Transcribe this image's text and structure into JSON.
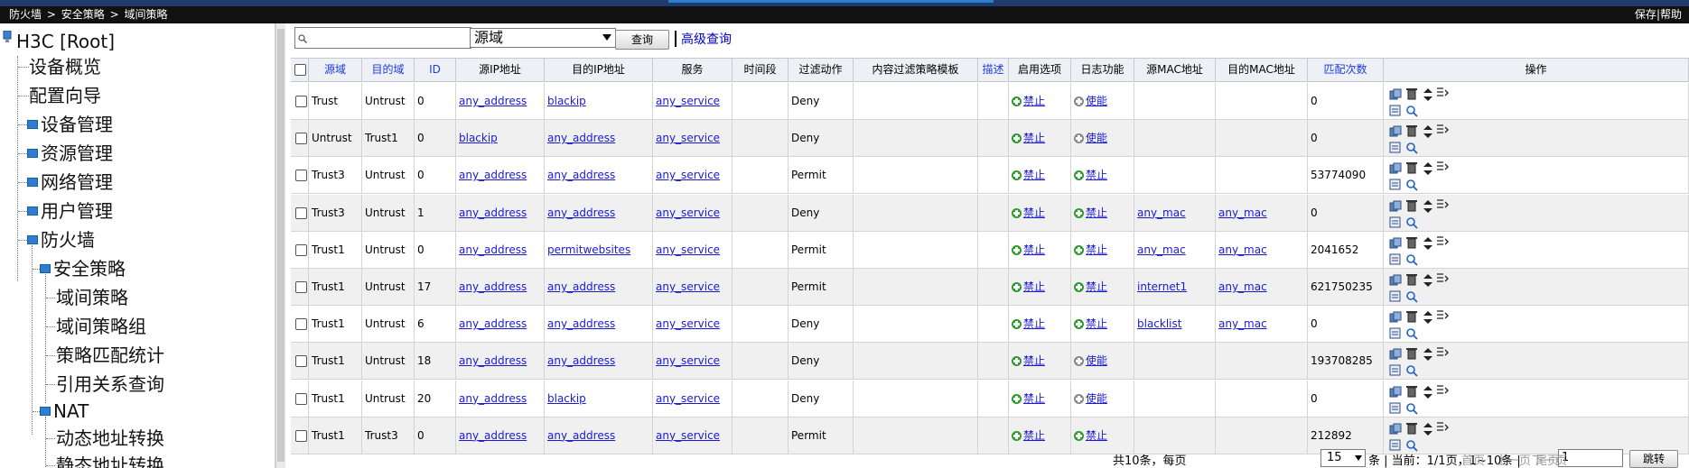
{
  "breadcrumb": [
    "防火墙",
    ">",
    "安全策略",
    ">",
    "域间策略"
  ],
  "top_links": {
    "save": "保存",
    "sep": "|",
    "help": "帮助"
  },
  "sidebar": {
    "root": "H3C [Root]",
    "items": [
      {
        "label": "设备概览"
      },
      {
        "label": "配置向导"
      },
      {
        "label": "设备管理"
      },
      {
        "label": "资源管理"
      },
      {
        "label": "网络管理"
      },
      {
        "label": "用户管理"
      },
      {
        "label": "防火墙"
      },
      {
        "label": "安全策略"
      },
      {
        "label": "域间策略"
      },
      {
        "label": "域间策略组"
      },
      {
        "label": "策略匹配统计"
      },
      {
        "label": "引用关系查询"
      },
      {
        "label": "NAT"
      },
      {
        "label": "动态地址转换"
      },
      {
        "label": "静态地址转换"
      }
    ]
  },
  "search": {
    "placeholder": "",
    "field_value": "源域",
    "query_label": "查询",
    "advanced_label": "高级查询"
  },
  "table": {
    "headers": [
      "源域",
      "目的域",
      "ID",
      "源IP地址",
      "目的IP地址",
      "服务",
      "时间段",
      "过滤动作",
      "内容过滤策略模板",
      "描述",
      "启用选项",
      "日志功能",
      "源MAC地址",
      "目的MAC地址",
      "匹配次数",
      "操作"
    ],
    "sortable": [
      true,
      true,
      true,
      false,
      false,
      false,
      false,
      false,
      false,
      true,
      false,
      false,
      false,
      false,
      true,
      false
    ],
    "rows": [
      [
        "Trust",
        "Untrust",
        "0",
        "any_address",
        "blackip",
        "any_service",
        "",
        "Deny",
        "",
        "",
        "禁止",
        "使能",
        "",
        "",
        "0"
      ],
      [
        "Untrust",
        "Trust1",
        "0",
        "blackip",
        "any_address",
        "any_service",
        "",
        "Deny",
        "",
        "",
        "禁止",
        "使能",
        "",
        "",
        "0"
      ],
      [
        "Trust3",
        "Untrust",
        "0",
        "any_address",
        "any_address",
        "any_service",
        "",
        "Permit",
        "",
        "",
        "禁止",
        "禁止",
        "",
        "",
        "53774090"
      ],
      [
        "Trust3",
        "Untrust",
        "1",
        "any_address",
        "any_address",
        "any_service",
        "",
        "Deny",
        "",
        "",
        "禁止",
        "禁止",
        "any_mac",
        "any_mac",
        "0"
      ],
      [
        "Trust1",
        "Untrust",
        "0",
        "any_address",
        "permitwebsites",
        "any_service",
        "",
        "Permit",
        "",
        "",
        "禁止",
        "禁止",
        "any_mac",
        "any_mac",
        "2041652"
      ],
      [
        "Trust1",
        "Untrust",
        "17",
        "any_address",
        "any_address",
        "any_service",
        "",
        "Permit",
        "",
        "",
        "禁止",
        "禁止",
        "internet1",
        "any_mac",
        "621750235"
      ],
      [
        "Trust1",
        "Untrust",
        "6",
        "any_address",
        "any_address",
        "any_service",
        "",
        "Deny",
        "",
        "",
        "禁止",
        "禁止",
        "blacklist",
        "any_mac",
        "0"
      ],
      [
        "Trust1",
        "Untrust",
        "18",
        "any_address",
        "any_address",
        "any_service",
        "",
        "Deny",
        "",
        "",
        "禁止",
        "使能",
        "",
        "",
        "193708285"
      ],
      [
        "Trust1",
        "Untrust",
        "20",
        "any_address",
        "blackip",
        "any_service",
        "",
        "Deny",
        "",
        "",
        "禁止",
        "使能",
        "",
        "",
        "0"
      ],
      [
        "Trust1",
        "Trust3",
        "0",
        "any_address",
        "any_address",
        "any_service",
        "",
        "Permit",
        "",
        "",
        "禁止",
        "禁止",
        "",
        "",
        "212892"
      ]
    ],
    "enable_states": [
      "green",
      "green",
      "green",
      "green",
      "green",
      "green",
      "green",
      "green",
      "green",
      "green"
    ],
    "log_states": [
      "gray",
      "gray",
      "green",
      "green",
      "green",
      "green",
      "green",
      "gray",
      "gray",
      "green"
    ]
  },
  "pager": {
    "total": "共10条，每页",
    "page_size": "15",
    "current": "条 | 当前：1/1页，1~10条 |",
    "first": "首页",
    "prev": "上一页",
    "next": "下一页",
    "last": "尾页",
    "page_input": "1",
    "jump": "跳转"
  },
  "colors": {
    "header_bg": "#eef0f5",
    "sort_link": "#1a3de0",
    "link": "#1a1ad6",
    "row_alt": "#f0f0f0",
    "topbar": "#111111"
  }
}
